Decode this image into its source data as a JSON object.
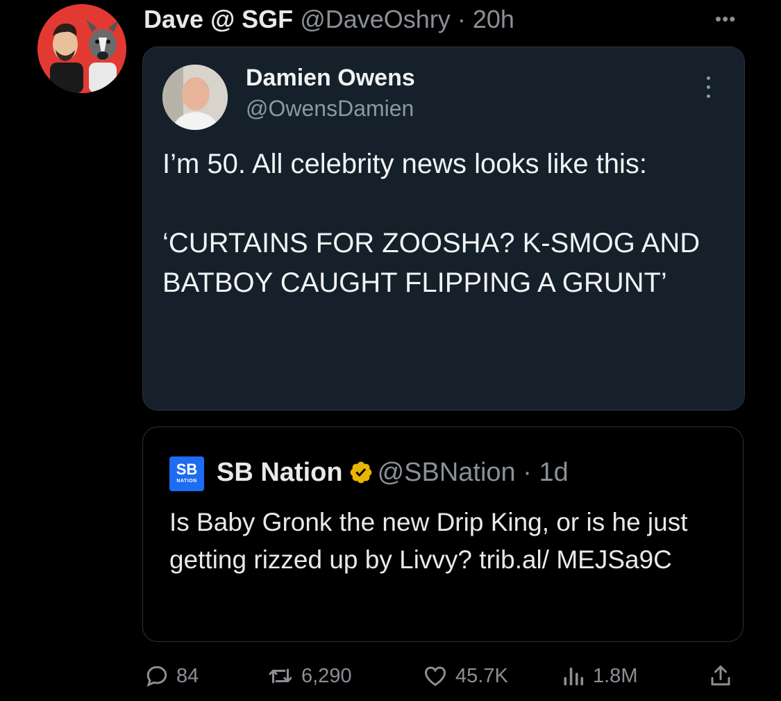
{
  "author": {
    "name": "Dave @ SGF",
    "handle": "@DaveOshry",
    "separator": " · ",
    "time": "20h"
  },
  "screenshot_tweet": {
    "name": "Damien Owens",
    "handle": "@OwensDamien",
    "text_line1": "I’m 50. All celebrity news looks like this:",
    "text_line2": "‘CURTAINS FOR ZOOSHA? K-SMOG AND BATBOY CAUGHT FLIPPING A GRUNT’"
  },
  "quoted_tweet": {
    "logo_text": "SB",
    "logo_subtext": "NATION",
    "name": "SB Nation",
    "handle": "@SBNation",
    "separator": " · ",
    "time": "1d",
    "text": "Is Baby Gronk the new Drip King, or is he just getting rizzed up by Livvy? trib.al/ MEJSa9C"
  },
  "actions": {
    "replies": "84",
    "retweets": "6,290",
    "likes": "45.7K",
    "views": "1.8M"
  },
  "colors": {
    "background": "#000000",
    "card": "#15202b",
    "muted": "#8b9096",
    "verified": "#e8b600",
    "avatar_bg": "#e23a32"
  }
}
